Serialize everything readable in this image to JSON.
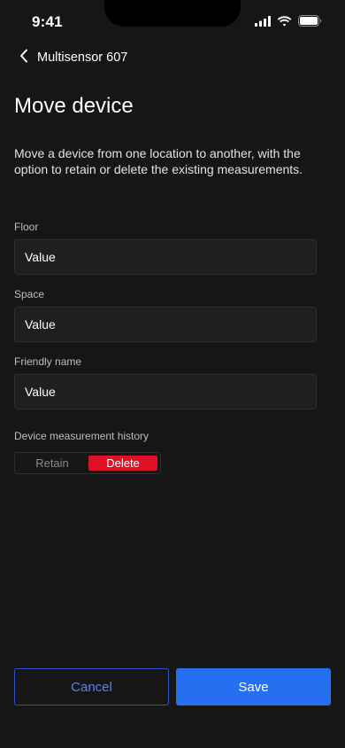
{
  "status_bar": {
    "time": "9:41",
    "icons": [
      "cellular-signal-icon",
      "wifi-icon",
      "battery-icon"
    ]
  },
  "nav": {
    "back_label": "Multisensor 607",
    "back_icon": "chevron-left-icon"
  },
  "page": {
    "title": "Move device",
    "description": "Move a device from one location to another, with the option to retain or delete the existing measurements."
  },
  "form": {
    "floor": {
      "label": "Floor",
      "value": "Value"
    },
    "space": {
      "label": "Space",
      "value": "Value"
    },
    "friendly_name": {
      "label": "Friendly name",
      "value": "Value"
    },
    "history": {
      "label": "Device measurement history",
      "options": [
        "Retain",
        "Delete"
      ],
      "selected": "Delete"
    }
  },
  "actions": {
    "cancel_label": "Cancel",
    "save_label": "Save"
  },
  "colors": {
    "background": "#161616",
    "field_background": "#1f1f1f",
    "delete_active": "#e01124",
    "primary": "#266ff0",
    "cancel_outline": "#2f4fc9"
  }
}
